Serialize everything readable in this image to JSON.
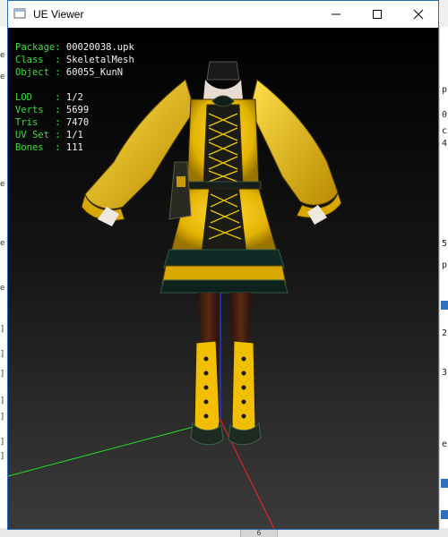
{
  "window": {
    "title": "UE Viewer",
    "controls": {
      "minimize_icon": "minimize-icon",
      "maximize_icon": "maximize-icon",
      "close_icon": "close-icon"
    }
  },
  "info": {
    "package_label": "Package:",
    "package_value": "00020038.upk",
    "class_label": "Class  :",
    "class_value": "SkeletalMesh",
    "object_label": "Object :",
    "object_value": "60055_KunN",
    "lod_label": "LOD    :",
    "lod_value": "1/2",
    "verts_label": "Verts  :",
    "verts_value": "5699",
    "tris_label": "Tris   :",
    "tris_value": "7470",
    "uvset_label": "UV Set :",
    "uvset_value": "1/1",
    "bones_label": "Bones  :",
    "bones_value": "111"
  },
  "axes": {
    "x_color": "#ff2020",
    "y_color": "#20e020",
    "z_color": "#2a3cff"
  },
  "colors": {
    "accent_yellow": "#f2c400",
    "label_green": "#3fdc3f",
    "window_border": "#2b6cb8"
  },
  "background": {
    "left_chips": [
      "e",
      "e",
      "e",
      "e",
      "e",
      "]",
      "]",
      "]",
      "]",
      "]",
      "]",
      "]"
    ],
    "right_frags": [
      "p",
      "0",
      "c",
      "4",
      "5",
      "p",
      "2",
      "3",
      "e"
    ],
    "bottom_tab": "6"
  }
}
